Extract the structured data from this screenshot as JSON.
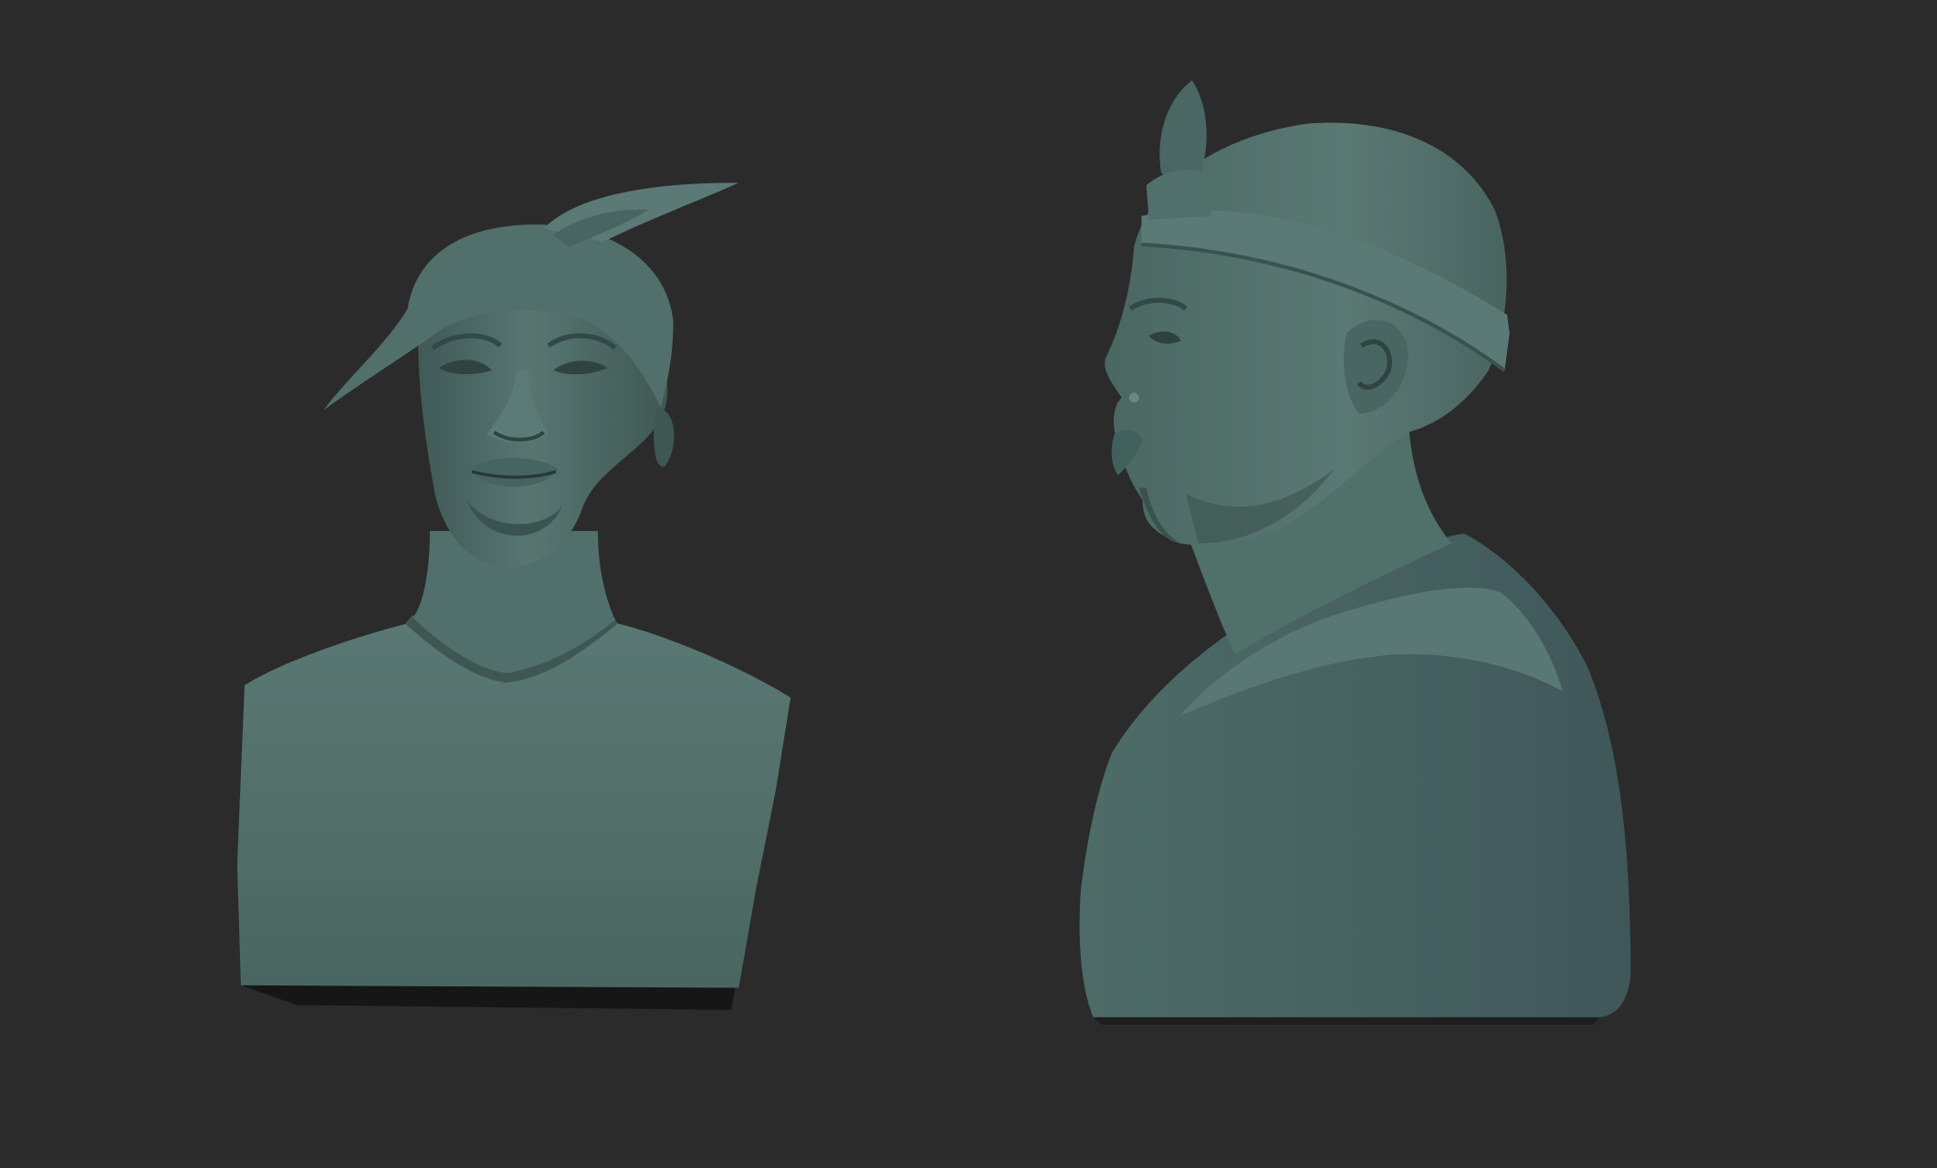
{
  "scene": {
    "background_color": "#2b2b2b",
    "model_color": "#4c6964",
    "model_shadow_color": "#3a4f4c",
    "model_highlight_color": "#5f7d78",
    "views": [
      {
        "name": "front-view",
        "description_icon": "bust-front-icon"
      },
      {
        "name": "side-view",
        "description_icon": "bust-profile-icon"
      }
    ]
  }
}
